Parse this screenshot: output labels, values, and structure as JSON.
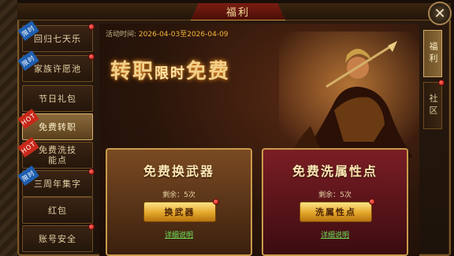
{
  "window": {
    "title": "福利"
  },
  "close_icon": "close-icon",
  "sidebar": {
    "items": [
      {
        "label": "回归七天乐",
        "tag": "限时",
        "tag_type": "new",
        "dot": true
      },
      {
        "label": "家族许愿池",
        "tag": "限时",
        "tag_type": "new",
        "dot": true
      },
      {
        "label": "节日礼包",
        "tag": "",
        "tag_type": "",
        "dot": false
      },
      {
        "label": "免费转职",
        "tag": "HOT",
        "tag_type": "hot",
        "dot": false,
        "active": true
      },
      {
        "label": "免费洗技能点",
        "tag": "HOT",
        "tag_type": "hot",
        "dot": false
      },
      {
        "label": "三周年集字",
        "tag": "限时",
        "tag_type": "new",
        "dot": true
      },
      {
        "label": "红包",
        "tag": "",
        "tag_type": "",
        "dot": false
      },
      {
        "label": "账号安全",
        "tag": "",
        "tag_type": "",
        "dot": true
      }
    ]
  },
  "right_tabs": [
    {
      "label": "福利",
      "active": true
    },
    {
      "label": "社区",
      "active": false
    }
  ],
  "main": {
    "time_label": "活动时间:",
    "time_range": "2026-04-03至2026-04-09",
    "banner_main": "转职",
    "banner_sub": "限时",
    "banner_end": "免费",
    "cards": [
      {
        "title": "免费换武器",
        "remain": "剩余：5次",
        "button": "换武器",
        "detail": "详细说明"
      },
      {
        "title": "免费洗属性点",
        "remain": "剩余：5次",
        "button": "洗属性点",
        "detail": "详细说明"
      }
    ]
  },
  "colors": {
    "accent": "#f5b63a",
    "link": "#6ee35a",
    "badge_red": "#c01010"
  }
}
